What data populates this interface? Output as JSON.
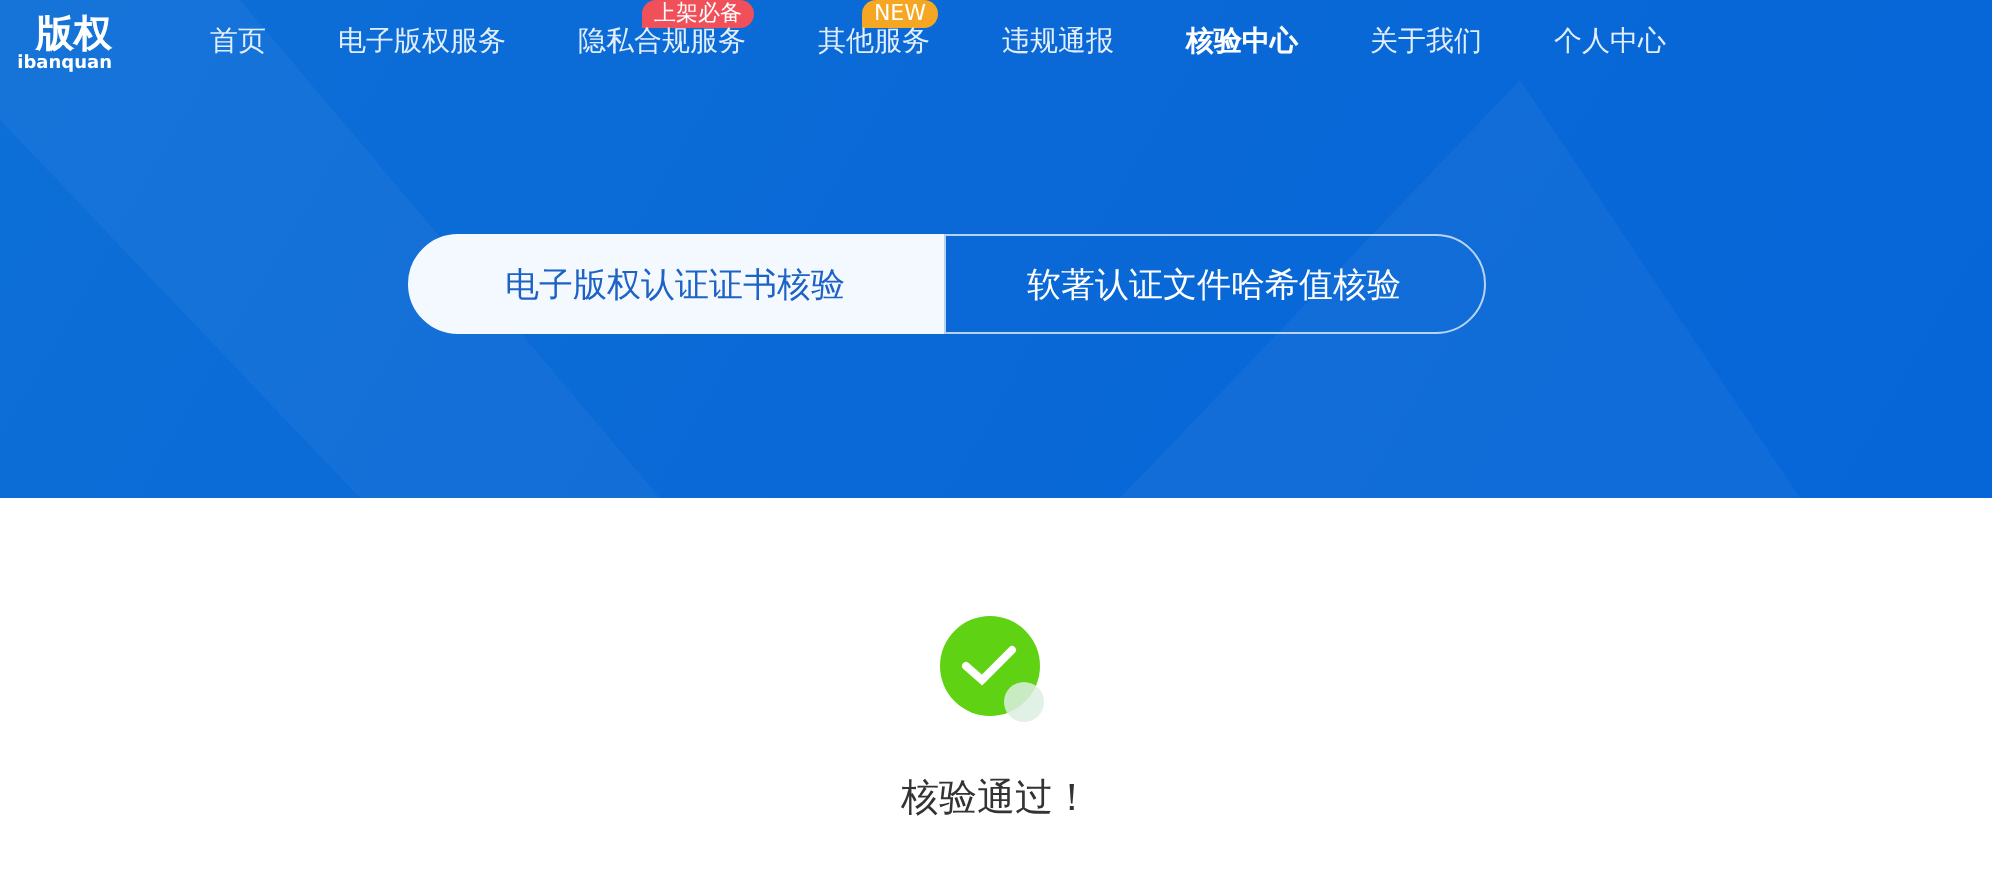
{
  "logo": {
    "name": "版权",
    "subtitle": "ibanquan"
  },
  "nav": [
    {
      "label": "首页",
      "selected": false
    },
    {
      "label": "电子版权服务",
      "selected": false
    },
    {
      "label": "隐私合规服务",
      "selected": false,
      "badge": {
        "text": "上架必备",
        "color": "#f0505a"
      }
    },
    {
      "label": "其他服务",
      "selected": false,
      "badge": {
        "text": "NEW",
        "color": "#f5a623"
      }
    },
    {
      "label": "违规通报",
      "selected": false
    },
    {
      "label": "核验中心",
      "selected": true
    },
    {
      "label": "关于我们",
      "selected": false
    },
    {
      "label": "个人中心",
      "selected": false
    }
  ],
  "tabs": [
    {
      "label": "电子版权认证证书核验",
      "selected": true
    },
    {
      "label": "软著认证文件哈希值核验",
      "selected": false
    }
  ],
  "result": {
    "message": "核验通过！"
  }
}
